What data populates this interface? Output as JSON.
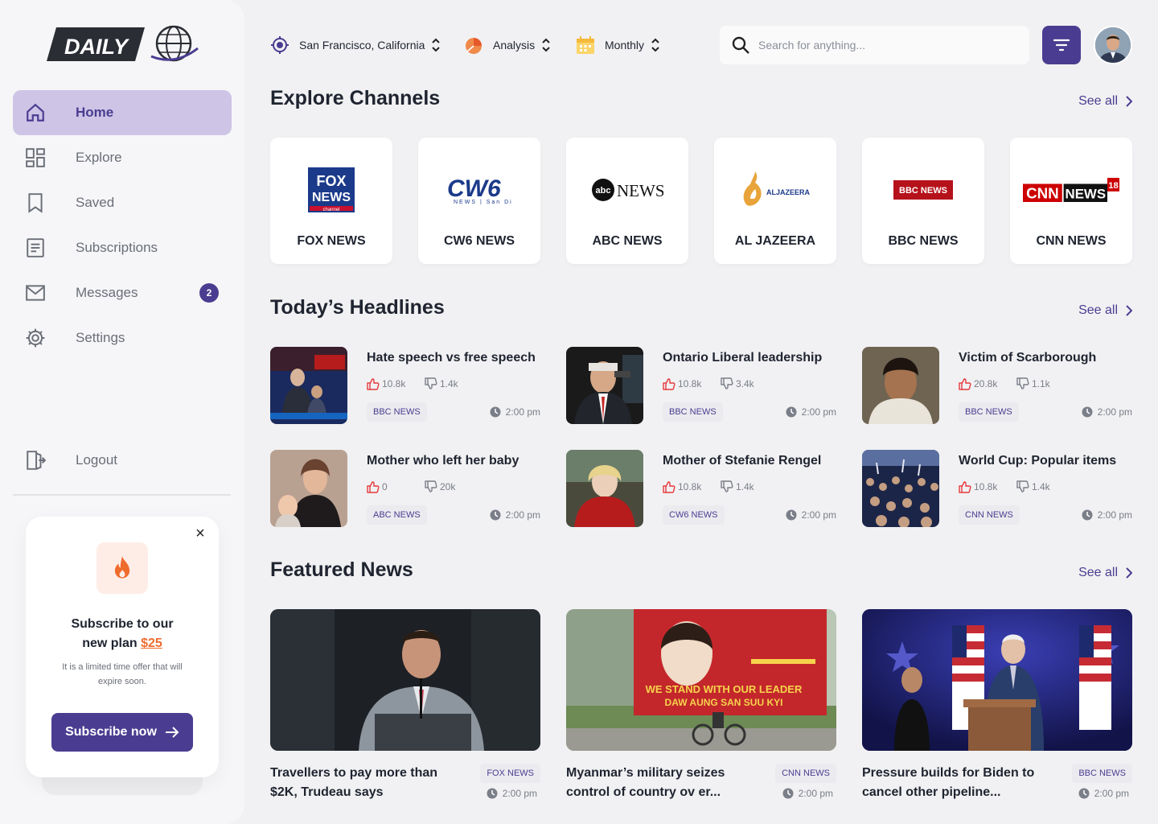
{
  "brand": {
    "logo_text": "DAILY"
  },
  "sidebar": {
    "items": [
      {
        "label": "Home",
        "icon": "home-icon",
        "active": true
      },
      {
        "label": "Explore",
        "icon": "grid-icon"
      },
      {
        "label": "Saved",
        "icon": "bookmark-icon"
      },
      {
        "label": "Subscriptions",
        "icon": "document-icon"
      },
      {
        "label": "Messages",
        "icon": "mail-icon",
        "badge": "2"
      },
      {
        "label": "Settings",
        "icon": "gear-icon"
      }
    ],
    "logout_label": "Logout"
  },
  "promo": {
    "title_line1": "Subscribe to our",
    "title_line2": "new plan ",
    "price": "$25",
    "description": "It is a limited time offer that will expire soon.",
    "button_label": "Subscribe now"
  },
  "topbar": {
    "location": "San Francisco, California",
    "mode": "Analysis",
    "period": "Monthly",
    "search_placeholder": "Search for anything..."
  },
  "sections": {
    "channels_title": "Explore Channels",
    "headlines_title": "Today’s Headlines",
    "featured_title": "Featured News",
    "see_all": "See all"
  },
  "channels": [
    {
      "name": "FOX NEWS"
    },
    {
      "name": "CW6 NEWS"
    },
    {
      "name": "ABC NEWS"
    },
    {
      "name": "AL JAZEERA",
      "logo_text": "ALJAZEERA"
    },
    {
      "name": "BBC NEWS",
      "logo_text": "BBC NEWS"
    },
    {
      "name": "CNN NEWS",
      "logo_text": "NEWS",
      "logo_badge": "18"
    }
  ],
  "headlines": [
    {
      "title": "Hate speech vs free speech",
      "likes": "10.8k",
      "dislikes": "1.4k",
      "source": "BBC NEWS",
      "time": "2:00 pm"
    },
    {
      "title": "Ontario Liberal leadership",
      "likes": "10.8k",
      "dislikes": "3.4k",
      "source": "BBC NEWS",
      "time": "2:00 pm"
    },
    {
      "title": "Victim of Scarborough",
      "likes": "20.8k",
      "dislikes": "1.1k",
      "source": "BBC NEWS",
      "time": "2:00 pm"
    },
    {
      "title": "Mother who left her baby",
      "likes": "0",
      "dislikes": "20k",
      "source": "ABC NEWS",
      "time": "2:00 pm"
    },
    {
      "title": "Mother of Stefanie Rengel",
      "likes": "10.8k",
      "dislikes": "1.4k",
      "source": "CW6 NEWS",
      "time": "2:00 pm"
    },
    {
      "title": "World   Cup: Popular items",
      "likes": "10.8k",
      "dislikes": "1.4k",
      "source": "CNN NEWS",
      "time": "2:00 pm"
    }
  ],
  "featured": [
    {
      "title": "Travellers to pay more than $2K, Trudeau says",
      "source": "FOX NEWS",
      "time": "2:00 pm"
    },
    {
      "title": "Myanmar’s military seizes control of country ov  er...",
      "source": "CNN NEWS",
      "time": "2:00 pm",
      "banner_text_1": "WE STAND WITH OUR LEADER",
      "banner_text_2": "DAW AUNG SAN SUU KYI"
    },
    {
      "title": "Pressure builds for Biden to cancel other pipeline...",
      "source": "BBC NEWS",
      "time": "2:00 pm"
    }
  ],
  "colors": {
    "primary": "#4a3d91",
    "active_bg": "#cdc4e6",
    "accent": "#ee6b2e",
    "like": "#e5393b"
  }
}
